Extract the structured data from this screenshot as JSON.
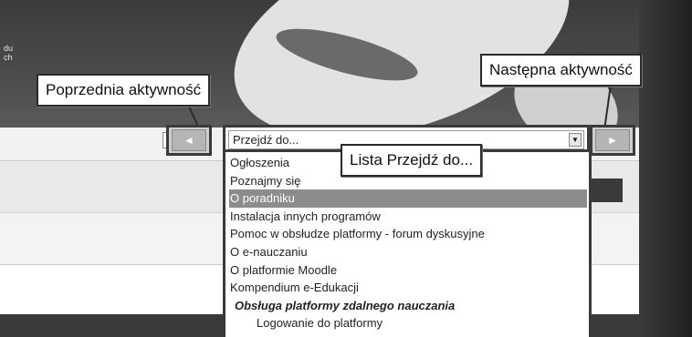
{
  "banner": {
    "text_lines": [
      "du",
      "ch"
    ]
  },
  "callouts": {
    "prev": "Poprzednia aktywność",
    "next": "Następna aktywność",
    "list": "Lista Przejdź do..."
  },
  "nav": {
    "prev_glyph": "◄",
    "next_glyph": "►",
    "expand_glyph": "⊹"
  },
  "jump_select": {
    "value": "Przejdź do...",
    "arrow": "▼"
  },
  "dropdown": {
    "items": [
      {
        "label": "Ogłoszenia",
        "type": "item"
      },
      {
        "label": "Poznajmy się",
        "type": "item"
      },
      {
        "label": "O poradniku",
        "type": "selected"
      },
      {
        "label": "Instalacja innych programów",
        "type": "item"
      },
      {
        "label": "Pomoc w obsłudze platformy - forum dyskusyjne",
        "type": "item"
      },
      {
        "label": "O e-nauczaniu",
        "type": "item"
      },
      {
        "label": "O platformie Moodle",
        "type": "item"
      },
      {
        "label": "Kompendium e-Edukacji",
        "type": "item"
      },
      {
        "label": "Obsługa platformy zdalnego nauczania",
        "type": "group"
      },
      {
        "label": "Logowanie do platformy",
        "type": "sub"
      }
    ]
  }
}
